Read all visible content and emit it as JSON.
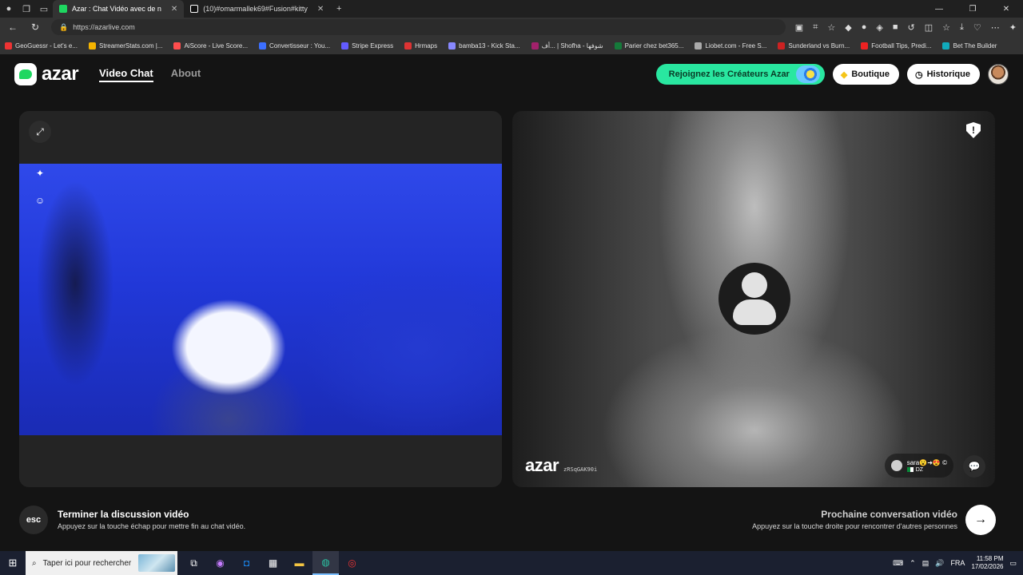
{
  "browser": {
    "tabs": [
      {
        "title": "Azar : Chat Vidéo avec de n",
        "active": true,
        "fav_color": "#1ed760"
      },
      {
        "title": "(10)#omarmallek69#Fusion#kitty",
        "active": false,
        "fav_color": "#ffffff"
      }
    ],
    "url": "https://azarlive.com",
    "bookmarks": [
      {
        "label": "GeoGuessr - Let's e...",
        "color": "#e33"
      },
      {
        "label": "StreamerStats.com |...",
        "color": "#f5b400"
      },
      {
        "label": "AiScore - Live Score...",
        "color": "#ff4d4d"
      },
      {
        "label": "Convertisseur : You...",
        "color": "#3c6fff"
      },
      {
        "label": "Stripe Express",
        "color": "#635bff"
      },
      {
        "label": "Hrmaps",
        "color": "#d33"
      },
      {
        "label": "bamba13 - Kick Sta...",
        "color": "#8888ff"
      },
      {
        "label": "أف... | Shofha - شوفها",
        "color": "#a1216b"
      },
      {
        "label": "Parier chez bet365...",
        "color": "#157a3a"
      },
      {
        "label": "Liobet.com - Free S...",
        "color": "#aaa"
      },
      {
        "label": "Sunderland vs Burn...",
        "color": "#c22"
      },
      {
        "label": "Football Tips, Predi...",
        "color": "#e22"
      },
      {
        "label": "Bet The Builder",
        "color": "#1ab"
      }
    ]
  },
  "header": {
    "logo": "azar",
    "nav": {
      "video_chat": "Video Chat",
      "about": "About"
    },
    "creators_label": "Rejoignez les Créateurs Azar",
    "shop_label": "Boutique",
    "history_label": "Historique"
  },
  "peer": {
    "watermark": "azar",
    "watermark_id": "zRSqGAK90i",
    "name": "sara😮➜😍 ©",
    "country": "DZ"
  },
  "footer": {
    "esc_key": "esc",
    "end_title": "Terminer la discussion vidéo",
    "end_sub": "Appuyez sur la touche échap pour mettre fin au chat vidéo.",
    "next_title": "Prochaine conversation vidéo",
    "next_sub": "Appuyez sur la touche droite pour rencontrer d'autres personnes"
  },
  "taskbar": {
    "search_placeholder": "Taper ici pour rechercher",
    "lang": "FRA",
    "time": "11:58 PM",
    "date": "17/02/2026"
  },
  "colors": {
    "brand_green": "#1ed760",
    "creators_bg": "#29e7a0"
  }
}
